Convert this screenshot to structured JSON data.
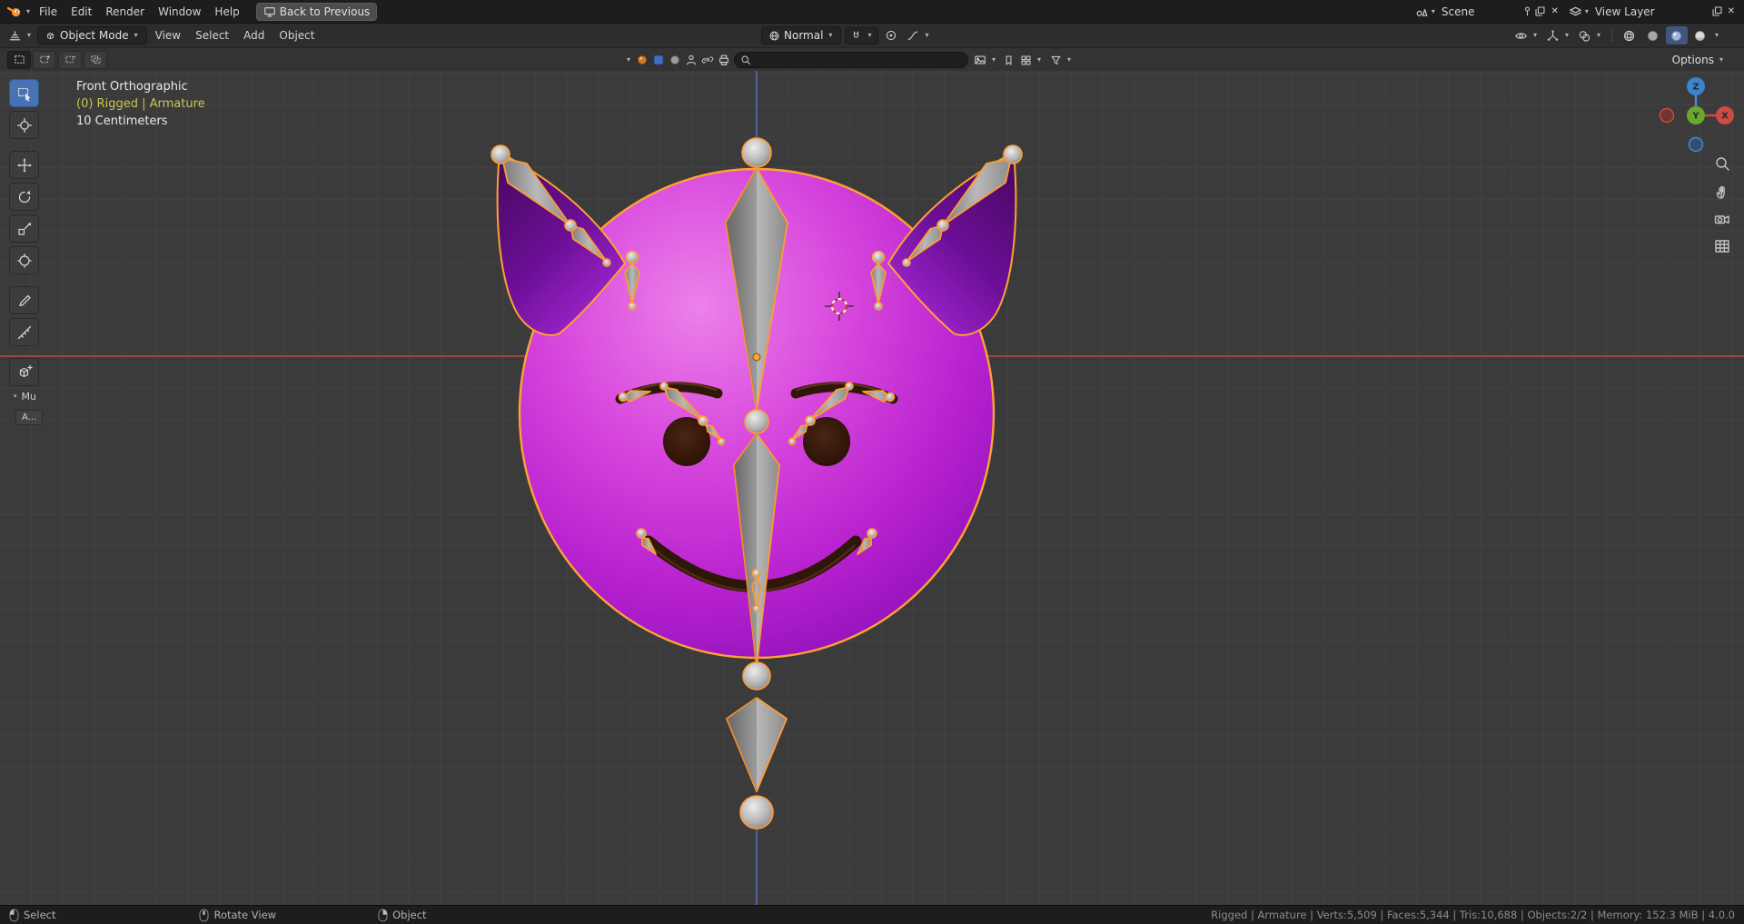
{
  "topbar": {
    "menus": [
      {
        "label": "File"
      },
      {
        "label": "Edit"
      },
      {
        "label": "Render"
      },
      {
        "label": "Window"
      },
      {
        "label": "Help"
      }
    ],
    "back_button": "Back to Previous",
    "scene": {
      "label": "Scene"
    },
    "view_layer": {
      "label": "View Layer"
    }
  },
  "header": {
    "mode": "Object Mode",
    "menus": [
      {
        "label": "View"
      },
      {
        "label": "Select"
      },
      {
        "label": "Add"
      },
      {
        "label": "Object"
      }
    ],
    "orientation": "Normal"
  },
  "tool_settings": {
    "options_label": "Options"
  },
  "viewport": {
    "view_label": "Front Orthographic",
    "object_label": "(0) Rigged | Armature",
    "scale_label": "10 Centimeters",
    "panel_tab": "Mu",
    "panel_button": "A...",
    "gizmo": {
      "x": "X",
      "y": "Y",
      "z": "Z"
    }
  },
  "statusbar": {
    "hints": [
      {
        "label": "Select"
      },
      {
        "label": "Rotate View"
      },
      {
        "label": "Object"
      }
    ],
    "stats": "Rigged | Armature | Verts:5,509 | Faces:5,344 | Tris:10,688 | Objects:2/2 | Memory: 152.3 MiB | 4.0.0"
  },
  "colors": {
    "selection_outline": "#ffa133",
    "active_tool": "#4772b3",
    "head": "#c32fd6",
    "horn": "#6b0f96",
    "face_features": "#2f1708",
    "axis_x": "#af4848",
    "axis_z": "#526aaa"
  }
}
